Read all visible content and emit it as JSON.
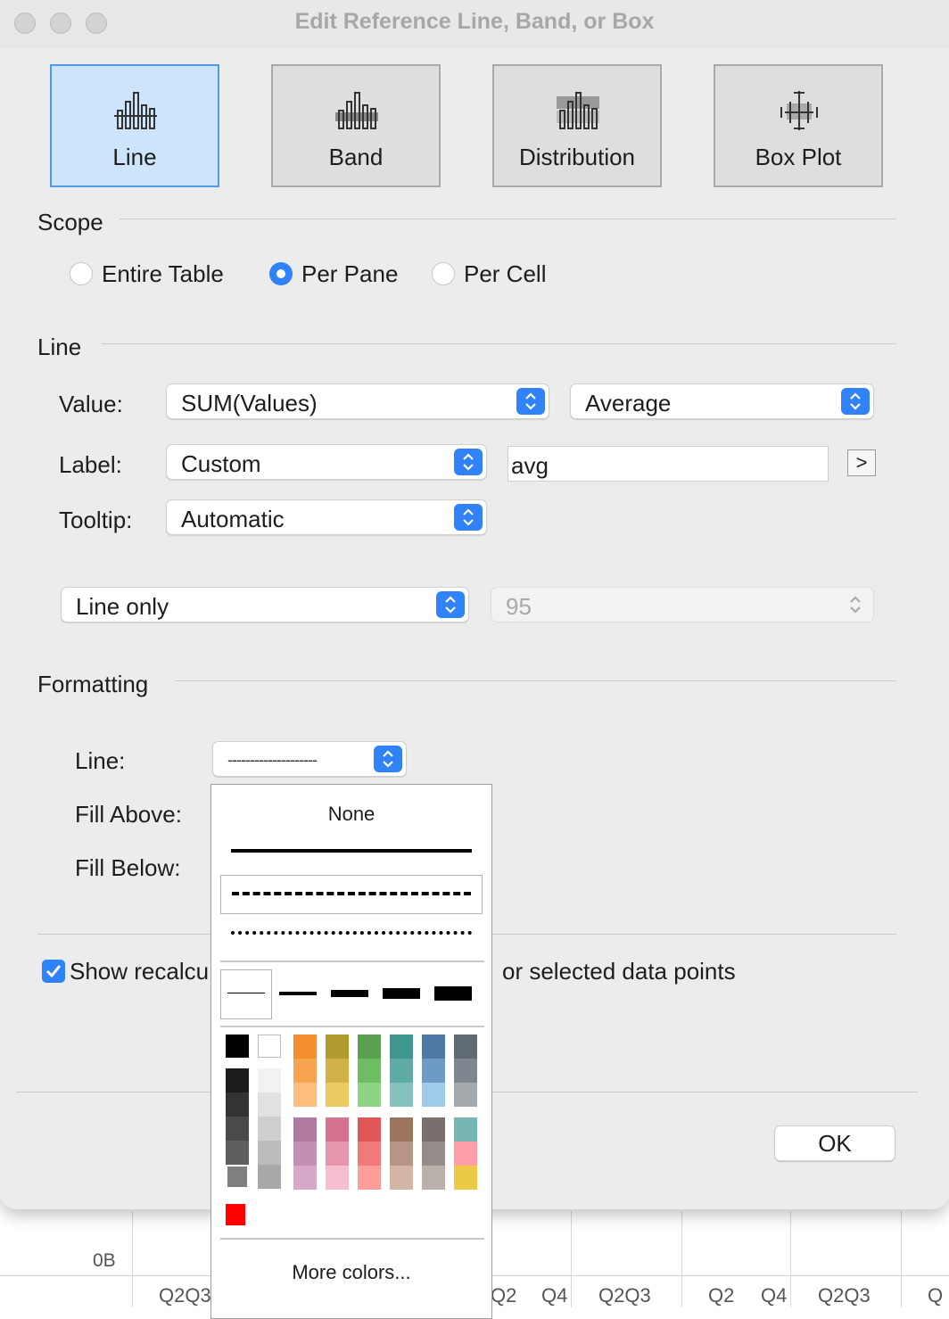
{
  "window": {
    "title": "Edit Reference Line, Band, or Box"
  },
  "types": [
    {
      "label": "Line",
      "icon": "reference-line-icon"
    },
    {
      "label": "Band",
      "icon": "reference-band-icon"
    },
    {
      "label": "Distribution",
      "icon": "distribution-icon"
    },
    {
      "label": "Box Plot",
      "icon": "box-plot-icon"
    }
  ],
  "selected_type": "Line",
  "scope": {
    "title": "Scope",
    "options": [
      "Entire Table",
      "Per Pane",
      "Per Cell"
    ],
    "selected": "Per Pane"
  },
  "line": {
    "title": "Line",
    "value_label": "Value:",
    "value_field": "SUM(Values)",
    "aggregation": "Average",
    "label_label": "Label:",
    "label_mode": "Custom",
    "label_text": "avg",
    "insert_button": ">",
    "tooltip_label": "Tooltip:",
    "tooltip_mode": "Automatic",
    "display_mode": "Line only",
    "confidence_value": "95"
  },
  "formatting": {
    "title": "Formatting",
    "line_label": "Line:",
    "line_preview": "--------------------",
    "fill_above_label": "Fill Above:",
    "fill_below_label": "Fill Below:"
  },
  "recalc": {
    "label_visible": "Show recalcu",
    "label_suffix": "or selected data points",
    "checked": true
  },
  "ok_label": "OK",
  "popup": {
    "none_label": "None",
    "patterns": [
      "solid",
      "dashed",
      "dotted"
    ],
    "selected_pattern": "dashed",
    "weights": [
      1,
      2,
      3,
      4,
      5
    ],
    "selected_weight": 1,
    "colors": {
      "basic": [
        "#000000",
        "#ffffff"
      ],
      "grays_dark": [
        "#1c1c1c",
        "#333333",
        "#4a4a4a",
        "#5f5f5f",
        "#7f7f7f"
      ],
      "grays_light": [
        "#f2f2f2",
        "#e1e1e1",
        "#cfcfcf",
        "#bcbcbc",
        "#a8a8a8"
      ],
      "row1": [
        [
          "#f28e2b",
          "#f7a350",
          "#ffbd80"
        ],
        [
          "#b39a2e",
          "#d1b247",
          "#ebcb61"
        ],
        [
          "#59a14f",
          "#6fbd62",
          "#8fd483"
        ],
        [
          "#3d9690",
          "#5eaba5",
          "#86c2bd"
        ],
        [
          "#4e79a7",
          "#6e9bc5",
          "#a0cbe8"
        ],
        [
          "#606a75",
          "#7e878f",
          "#a4aaae"
        ]
      ],
      "row2": [
        [
          "#b07aa1",
          "#c38fb4",
          "#d7a8c8"
        ],
        [
          "#d4728f",
          "#e595ac",
          "#f6bfcf"
        ],
        [
          "#e15759",
          "#f07a7a",
          "#ff9d9a"
        ],
        [
          "#9c755f",
          "#b79483",
          "#d3b4a5"
        ],
        [
          "#79706e",
          "#968c8a",
          "#bab0ac"
        ],
        [
          "#76b7b2",
          "#ff9da7",
          "#edc948"
        ]
      ],
      "recent": [
        "#ff0000"
      ]
    },
    "more_colors_label": "More colors..."
  },
  "background": {
    "axis_label": "0B",
    "ticks": [
      "Q2Q3",
      "Q2",
      "Q4",
      "Q2Q3",
      "Q2",
      "Q4",
      "Q2Q3",
      "Q"
    ]
  }
}
